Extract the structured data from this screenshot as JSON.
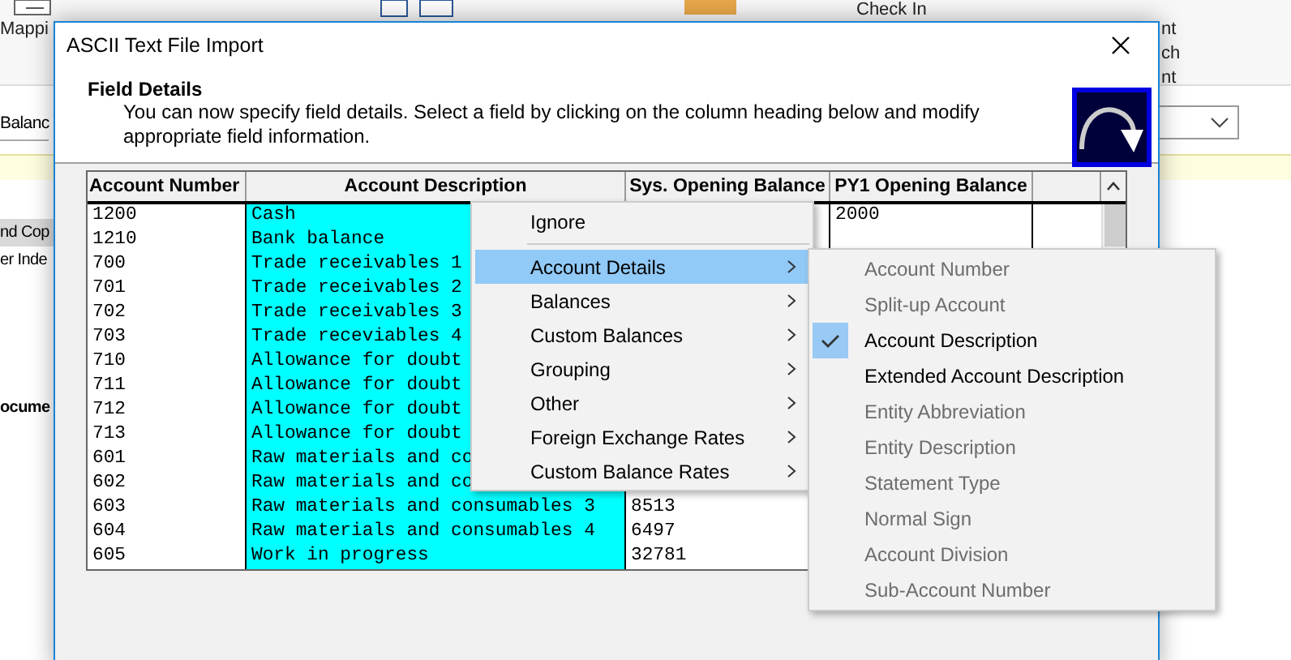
{
  "background": {
    "ribbon_label": "Mappi",
    "check_in": "Check In",
    "right_labels": [
      "nt",
      "ch",
      "nt"
    ],
    "field_text": "Balanc",
    "side_items": [
      {
        "label": "nd Cop",
        "selected": true
      },
      {
        "label": "er Inde",
        "selected": false
      },
      {
        "label": "ocume",
        "selected": false
      }
    ]
  },
  "dialog": {
    "title": "ASCII Text File Import",
    "section_title": "Field Details",
    "instructions": "You can now specify field details. Select a field by clicking on the column heading below and modify appropriate field information.",
    "table": {
      "columns": [
        {
          "label": "Account Number",
          "selected": false
        },
        {
          "label": "Account Description",
          "selected": true
        },
        {
          "label": "Sys. Opening Balance",
          "selected": false
        },
        {
          "label": "PY1 Opening Balance",
          "selected": false
        }
      ],
      "rows": [
        {
          "number": "1200",
          "description": "Cash",
          "py1": "2000"
        },
        {
          "number": "1210",
          "description": "Bank balance"
        },
        {
          "number": "700",
          "description": "Trade receivables 1"
        },
        {
          "number": "701",
          "description": "Trade receivables 2"
        },
        {
          "number": "702",
          "description": "Trade receivables 3"
        },
        {
          "number": "703",
          "description": "Trade receviables 4"
        },
        {
          "number": "710",
          "description": "Allowance for doubt"
        },
        {
          "number": "711",
          "description": "Allowance for doubt"
        },
        {
          "number": "712",
          "description": "Allowance for doubt"
        },
        {
          "number": "713",
          "description": "Allowance for doubt"
        },
        {
          "number": "601",
          "description": "Raw materials and co"
        },
        {
          "number": "602",
          "description": "Raw materials and co"
        },
        {
          "number": "603",
          "description": "Raw materials and consumables 3",
          "sys": "8513"
        },
        {
          "number": "604",
          "description": "Raw materials and consumables 4",
          "sys": "6497"
        },
        {
          "number": "605",
          "description": "Work in progress",
          "sys": "32781"
        }
      ]
    }
  },
  "context_menu": {
    "items": [
      {
        "label": "Ignore",
        "has_submenu": false,
        "selected": false
      },
      {
        "label": "Account Details",
        "has_submenu": true,
        "selected": true
      },
      {
        "label": "Balances",
        "has_submenu": true,
        "selected": false
      },
      {
        "label": "Custom Balances",
        "has_submenu": true,
        "selected": false
      },
      {
        "label": "Grouping",
        "has_submenu": true,
        "selected": false
      },
      {
        "label": "Other",
        "has_submenu": true,
        "selected": false
      },
      {
        "label": "Foreign Exchange Rates",
        "has_submenu": true,
        "selected": false
      },
      {
        "label": "Custom Balance Rates",
        "has_submenu": true,
        "selected": false
      }
    ]
  },
  "submenu": {
    "items": [
      {
        "label": "Account Number",
        "checked": false,
        "disabled": true
      },
      {
        "label": "Split-up Account",
        "checked": false,
        "disabled": true
      },
      {
        "label": "Account Description",
        "checked": true,
        "disabled": false
      },
      {
        "label": "Extended Account Description",
        "checked": false,
        "disabled": false
      },
      {
        "label": "Entity Abbreviation",
        "checked": false,
        "disabled": true
      },
      {
        "label": "Entity Description",
        "checked": false,
        "disabled": true
      },
      {
        "label": "Statement Type",
        "checked": false,
        "disabled": true
      },
      {
        "label": "Normal Sign",
        "checked": false,
        "disabled": true
      },
      {
        "label": "Account Division",
        "checked": false,
        "disabled": true
      },
      {
        "label": "Sub-Account Number",
        "checked": false,
        "disabled": true
      }
    ]
  }
}
